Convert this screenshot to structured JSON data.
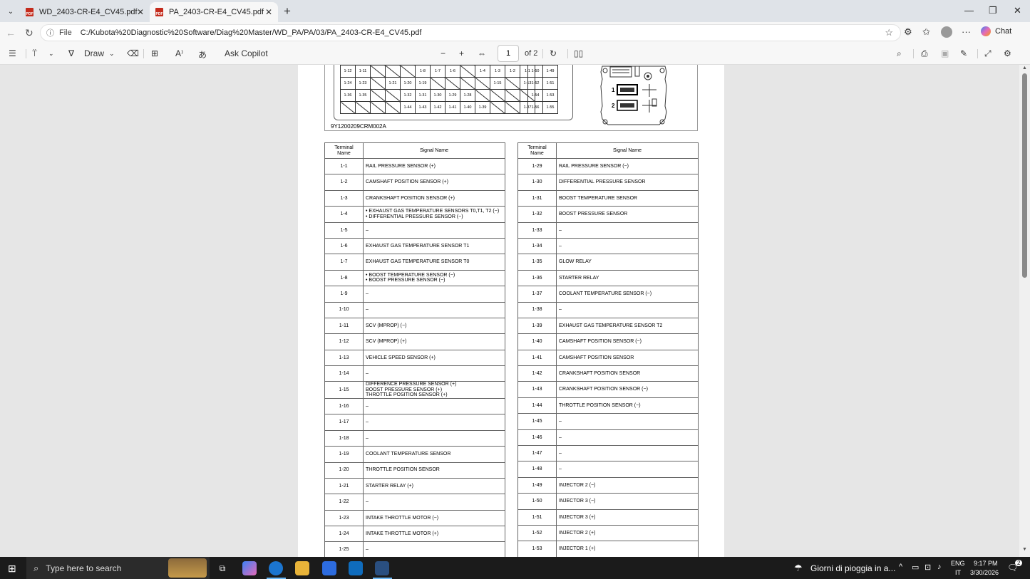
{
  "browser": {
    "tabs": [
      {
        "title": "WD_2403-CR-E4_CV45.pdf"
      },
      {
        "title": "PA_2403-CR-E4_CV45.pdf"
      }
    ],
    "address": {
      "label": "File",
      "url": "C:/Kubota%20Diagnostic%20Software/Diag%20Master/WD_PA/PA/03/PA_2403-CR-E4_CV45.pdf"
    },
    "chat_label": "Chat"
  },
  "pdf_toolbar": {
    "draw_label": "Draw",
    "ask_copilot": "Ask Copilot",
    "page_number": "1",
    "page_total": "of 2"
  },
  "diagram": {
    "code": "9Y1200209CRM002A",
    "connector_labels": [
      "1",
      "2"
    ],
    "pins_left": [
      [
        "1-12",
        "1-11",
        "",
        "",
        "",
        "1-8",
        "1-7",
        "1-6",
        "",
        "1-4",
        "1-3",
        "1-2",
        "1-1"
      ],
      [
        "1-24",
        "1-23",
        "",
        "1-21",
        "1-20",
        "1-19",
        "",
        "",
        "",
        "",
        "1-15",
        "",
        "1-13"
      ],
      [
        "1-36",
        "1-35",
        "",
        "",
        "1-32",
        "1-31",
        "1-30",
        "1-29",
        "1-28",
        "",
        "",
        "",
        ""
      ],
      [
        "",
        "",
        "",
        "",
        "1-44",
        "1-43",
        "1-42",
        "1-41",
        "1-40",
        "1-39",
        "",
        "",
        "1-37"
      ]
    ],
    "pins_right": [
      [
        "1-50",
        "1-49"
      ],
      [
        "1-52",
        "1-51"
      ],
      [
        "1-54",
        "1-53"
      ],
      [
        "1-56",
        "1-55"
      ]
    ]
  },
  "table_header": {
    "terminal": "Terminal Name",
    "signal": "Signal Name"
  },
  "left_rows": [
    {
      "t": "1-1",
      "s": "RAIL PRESSURE SENSOR (+)"
    },
    {
      "t": "1-2",
      "s": "CAMSHAFT POSITION SENSOR (+)"
    },
    {
      "t": "1-3",
      "s": "CRANKSHAFT POSITION SENSOR (+)"
    },
    {
      "t": "1-4",
      "s": "• EXHAUST GAS TEMPERATURE SENSORS T0,T1, T2 (−)\n• DIFFERENTIAL PRESSURE SENSOR (−)"
    },
    {
      "t": "1-5",
      "s": "–"
    },
    {
      "t": "1-6",
      "s": "EXHAUST GAS TEMPERATURE SENSOR T1"
    },
    {
      "t": "1-7",
      "s": "EXHAUST GAS TEMPERATURE SENSOR T0"
    },
    {
      "t": "1-8",
      "s": "• BOOST TEMPERATURE SENSOR (−)\n• BOOST PRESSURE SENSOR (−)"
    },
    {
      "t": "1-9",
      "s": "–"
    },
    {
      "t": "1-10",
      "s": "–"
    },
    {
      "t": "1-11",
      "s": "SCV (MPROP) (−)"
    },
    {
      "t": "1-12",
      "s": "SCV (MPROP) (+)"
    },
    {
      "t": "1-13",
      "s": "VEHICLE SPEED SENSOR (+)"
    },
    {
      "t": "1-14",
      "s": "–"
    },
    {
      "t": "1-15",
      "s": "DIFFERENCE PRESSURE SENSOR (+)\nBOOST PRESSURE SENSOR (+)\nTHROTTLE POSITION SENSOR (+)"
    },
    {
      "t": "1-16",
      "s": "–"
    },
    {
      "t": "1-17",
      "s": "–"
    },
    {
      "t": "1-18",
      "s": "–"
    },
    {
      "t": "1-19",
      "s": "COOLANT TEMPERATURE SENSOR"
    },
    {
      "t": "1-20",
      "s": "THROTTLE POSITION SENSOR"
    },
    {
      "t": "1-21",
      "s": "STARTER RELAY (+)"
    },
    {
      "t": "1-22",
      "s": "–"
    },
    {
      "t": "1-23",
      "s": "INTAKE THROTTLE MOTOR (−)"
    },
    {
      "t": "1-24",
      "s": "INTAKE THROTTLE MOTOR (+)"
    },
    {
      "t": "1-25",
      "s": "–"
    }
  ],
  "right_rows": [
    {
      "t": "1-29",
      "s": "RAIL PRESSURE SENSOR (−)"
    },
    {
      "t": "1-30",
      "s": "DIFFERENTIAL PRESSURE SENSOR"
    },
    {
      "t": "1-31",
      "s": "BOOST TEMPERATURE SENSOR"
    },
    {
      "t": "1-32",
      "s": "BOOST PRESSURE SENSOR"
    },
    {
      "t": "1-33",
      "s": "–"
    },
    {
      "t": "1-34",
      "s": "–"
    },
    {
      "t": "1-35",
      "s": "GLOW RELAY"
    },
    {
      "t": "1-36",
      "s": "STARTER RELAY"
    },
    {
      "t": "1-37",
      "s": "COOLANT TEMPERATURE SENSOR (−)"
    },
    {
      "t": "1-38",
      "s": "–"
    },
    {
      "t": "1-39",
      "s": "EXHAUST GAS TEMPERATURE SENSOR T2"
    },
    {
      "t": "1-40",
      "s": "CAMSHAFT POSITION SENSOR (−)"
    },
    {
      "t": "1-41",
      "s": "CAMSHAFT POSITION SENSOR"
    },
    {
      "t": "1-42",
      "s": "CRANKSHAFT POSITION SENSOR"
    },
    {
      "t": "1-43",
      "s": "CRANKSHAFT POSITION SENSOR (−)"
    },
    {
      "t": "1-44",
      "s": "THROTTLE POSITION SENSOR (−)"
    },
    {
      "t": "1-45",
      "s": "–"
    },
    {
      "t": "1-46",
      "s": "–"
    },
    {
      "t": "1-47",
      "s": "–"
    },
    {
      "t": "1-48",
      "s": "–"
    },
    {
      "t": "1-49",
      "s": "INJECTOR 2 (−)"
    },
    {
      "t": "1-50",
      "s": "INJECTOR 3 (−)"
    },
    {
      "t": "1-51",
      "s": "INJECTOR 3 (+)"
    },
    {
      "t": "1-52",
      "s": "INJECTOR 2 (+)"
    },
    {
      "t": "1-53",
      "s": "INJECTOR 1 (+)"
    }
  ],
  "taskbar": {
    "search_placeholder": "Type here to search",
    "weather": "Giorni di pioggia in a...",
    "lang": "ENG",
    "lang_region": "IT",
    "time": "9:17 PM",
    "date": "3/30/2026",
    "notifications": "2"
  }
}
